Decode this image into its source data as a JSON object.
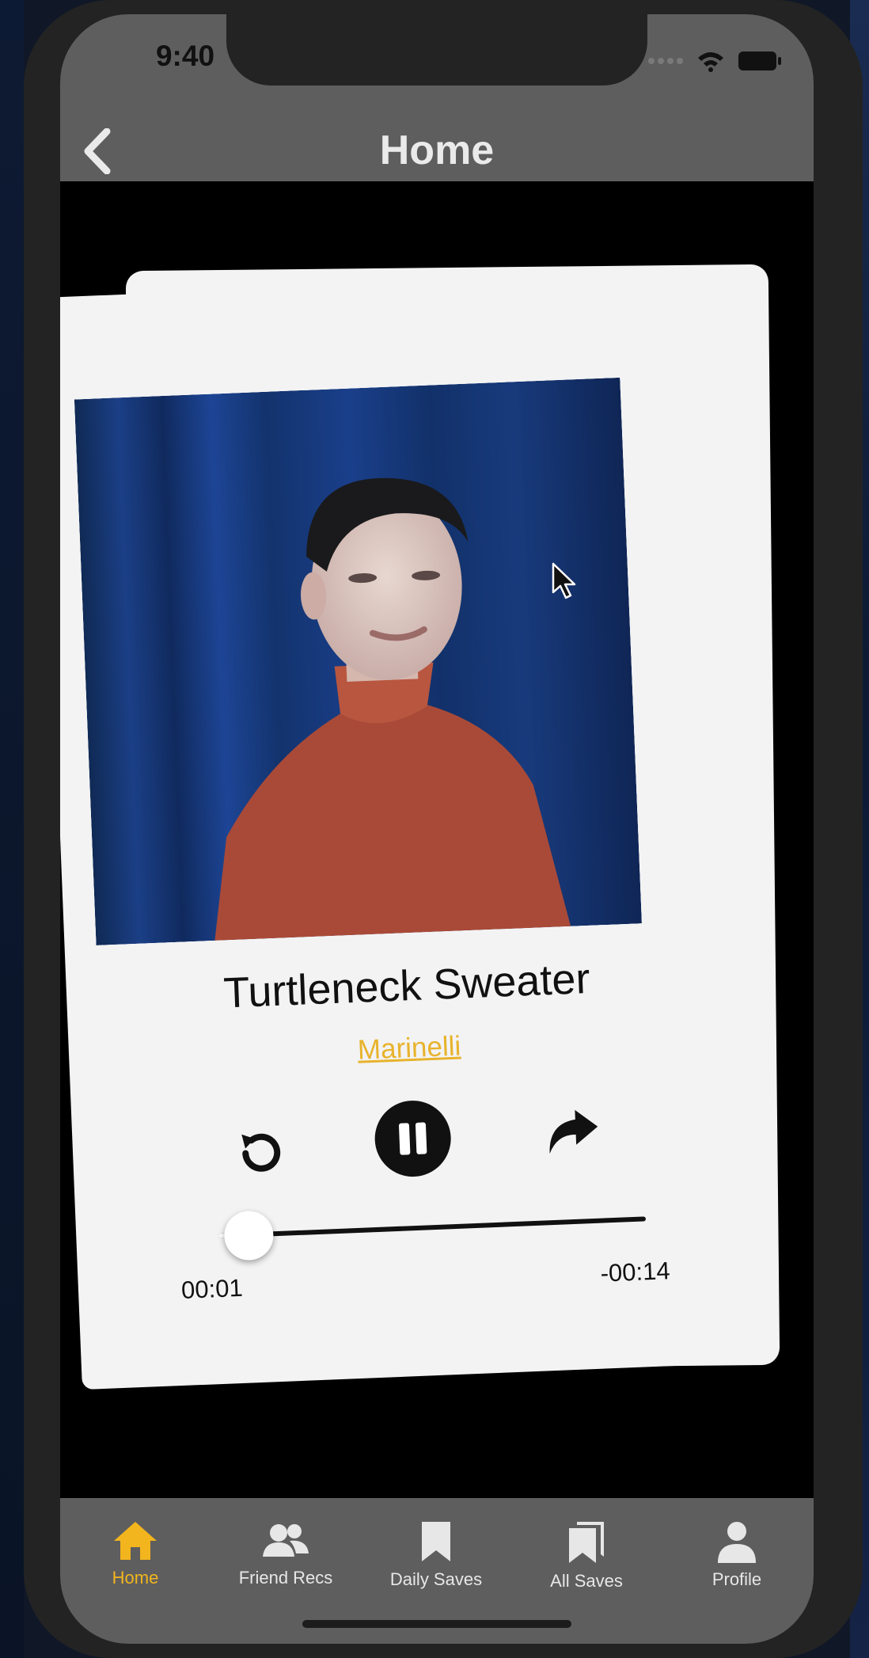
{
  "status_bar": {
    "time": "9:40"
  },
  "nav": {
    "title": "Home",
    "back_icon": "chevron-left-icon"
  },
  "player": {
    "song_title": "Turtleneck Sweater",
    "artist": "Marinelli",
    "elapsed": "00:01",
    "remaining": "-00:14",
    "progress_fraction": 0.07,
    "controls": [
      "replay-icon",
      "pause-icon",
      "share-forward-icon"
    ]
  },
  "tabbar": {
    "items": [
      {
        "label": "Home",
        "icon": "home-icon",
        "active": true
      },
      {
        "label": "Friend Recs",
        "icon": "friends-icon",
        "active": false
      },
      {
        "label": "Daily Saves",
        "icon": "bookmark-icon",
        "active": false
      },
      {
        "label": "All Saves",
        "icon": "bookmarks-stack-icon",
        "active": false
      },
      {
        "label": "Profile",
        "icon": "profile-icon",
        "active": false
      }
    ]
  },
  "colors": {
    "accent": "#f2b51d",
    "artist_link": "#e8b32c",
    "bar_background": "#5e5e5e",
    "card": "#f3f3f4"
  }
}
